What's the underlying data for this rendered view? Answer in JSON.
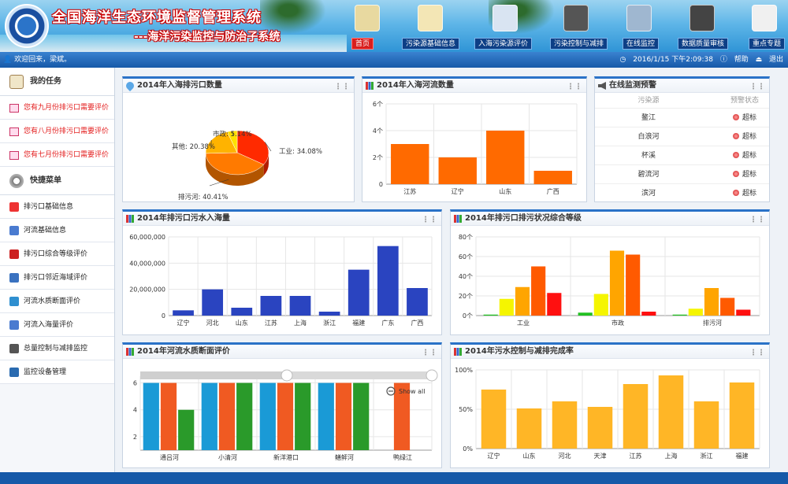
{
  "header": {
    "title": "全国海洋生态环境监督管理系统",
    "subtitle": "---海洋污染监控与防治子系统"
  },
  "nav": [
    {
      "label": "首页",
      "icon": "home-icon",
      "active": true
    },
    {
      "label": "污染源基础信息",
      "icon": "document-pencil-icon",
      "active": false
    },
    {
      "label": "入海污染源评价",
      "icon": "checklist-icon",
      "active": false
    },
    {
      "label": "污染控制与减排",
      "icon": "pipe-icon",
      "active": false
    },
    {
      "label": "在线监控",
      "icon": "monitor-icon",
      "active": false
    },
    {
      "label": "数据质量审核",
      "icon": "binoculars-icon",
      "active": false
    },
    {
      "label": "重点专题",
      "icon": "report-icon",
      "active": false
    }
  ],
  "status": {
    "welcome": "欢迎回来，梁斌。",
    "datetime": "2016/1/15 下午2:09:38",
    "help": "帮助",
    "logout": "退出"
  },
  "sidebar": {
    "tasks_title": "我的任务",
    "tasks": [
      "您有九月份排污口需要评价",
      "您有八月份排污口需要评价",
      "您有七月份排污口需要评价"
    ],
    "menu_title": "快捷菜单",
    "menu": [
      "排污口基础信息",
      "河流基础信息",
      "排污口综合等级评价",
      "排污口邻近海域评价",
      "河流水质断面评价",
      "河流入海量评价",
      "总量控制与减排监控",
      "监控设备管理"
    ]
  },
  "panels": {
    "pie": {
      "title": "2014年入海排污口数量"
    },
    "rivers": {
      "title": "2014年入海河流数量"
    },
    "alerts": {
      "title": "在线监测预警",
      "col_source": "污染源",
      "col_status": "预警状态",
      "rows": [
        {
          "source": "鳌江",
          "status": "超标"
        },
        {
          "source": "白浪河",
          "status": "超标"
        },
        {
          "source": "杯溪",
          "status": "超标"
        },
        {
          "source": "碧流河",
          "status": "超标"
        },
        {
          "source": "滨河",
          "status": "超标"
        }
      ]
    },
    "sewage": {
      "title": "2014年排污口污水入海量"
    },
    "grade": {
      "title": "2014年排污口排污状况综合等级"
    },
    "section": {
      "title": "2014年河流水质断面评价",
      "show_all": "Show all"
    },
    "control": {
      "title": "2014年污水控制与减排完成率"
    }
  },
  "chart_data": [
    {
      "id": "pie",
      "type": "pie",
      "title": "2014年入海排污口数量",
      "slices": [
        {
          "label": "工业: 34.08%",
          "value": 34.08,
          "color": "#ff2a00"
        },
        {
          "label": "排污河: 40.41%",
          "value": 40.41,
          "color": "#ff7a00"
        },
        {
          "label": "其他: 20.38%",
          "value": 20.38,
          "color": "#ffb300"
        },
        {
          "label": "市政: 5.14%",
          "value": 5.14,
          "color": "#ffe000"
        }
      ]
    },
    {
      "id": "rivers",
      "type": "bar",
      "title": "2014年入海河流数量",
      "categories": [
        "江苏",
        "辽宁",
        "山东",
        "广西"
      ],
      "values": [
        3,
        2,
        4,
        1
      ],
      "yticks": [
        "0",
        "2个",
        "4个",
        "6个"
      ],
      "ylim": [
        0,
        6
      ],
      "color": "#ff6a00"
    },
    {
      "id": "sewage",
      "type": "bar",
      "title": "2014年排污口污水入海量",
      "categories": [
        "辽宁",
        "河北",
        "山东",
        "江苏",
        "上海",
        "浙江",
        "福建",
        "广东",
        "广西"
      ],
      "values": [
        4000000,
        20000000,
        6000000,
        15000000,
        15000000,
        3000000,
        35000000,
        53000000,
        21000000
      ],
      "yticks": [
        "0",
        "20,000,000",
        "40,000,000",
        "60,000,000"
      ],
      "ylim": [
        0,
        60000000
      ],
      "color": "#2a44c0"
    },
    {
      "id": "grade",
      "type": "bar",
      "title": "2014年排污口排污状况综合等级",
      "categories": [
        "工业",
        "市政",
        "排污河"
      ],
      "series": [
        {
          "values": [
            1,
            3,
            1
          ],
          "color": "#22c022"
        },
        {
          "values": [
            17,
            22,
            7
          ],
          "color": "#f5f500"
        },
        {
          "values": [
            29,
            66,
            28
          ],
          "color": "#ffa500"
        },
        {
          "values": [
            50,
            62,
            18
          ],
          "color": "#ff5a00"
        },
        {
          "values": [
            23,
            4,
            6
          ],
          "color": "#ff1010"
        }
      ],
      "yticks": [
        "0个",
        "20个",
        "40个",
        "60个",
        "80个"
      ],
      "ylim": [
        0,
        80
      ]
    },
    {
      "id": "section",
      "type": "bar",
      "title": "2014年河流水质断面评价",
      "categories": [
        "通吕河",
        "小清河",
        "新洋港口",
        "鳝鲆河",
        "鸭绿江"
      ],
      "series": [
        {
          "values": [
            6,
            6,
            6,
            6,
            0
          ],
          "color": "#1a9ad6"
        },
        {
          "values": [
            6,
            6,
            6,
            6,
            6
          ],
          "color": "#f05a22"
        },
        {
          "values": [
            4,
            6,
            6,
            6,
            0
          ],
          "color": "#2a9a2a"
        }
      ],
      "yticks": [
        "2",
        "4",
        "6"
      ],
      "ylim": [
        1,
        6.5
      ]
    },
    {
      "id": "control",
      "type": "bar",
      "title": "2014年污水控制与减排完成率",
      "categories": [
        "辽宁",
        "山东",
        "河北",
        "天津",
        "江苏",
        "上海",
        "浙江",
        "福建"
      ],
      "values": [
        75,
        51,
        60,
        53,
        82,
        93,
        60,
        84
      ],
      "yticks": [
        "0%",
        "50%",
        "100%"
      ],
      "ylim": [
        0,
        100
      ],
      "color": "#ffb626"
    }
  ]
}
